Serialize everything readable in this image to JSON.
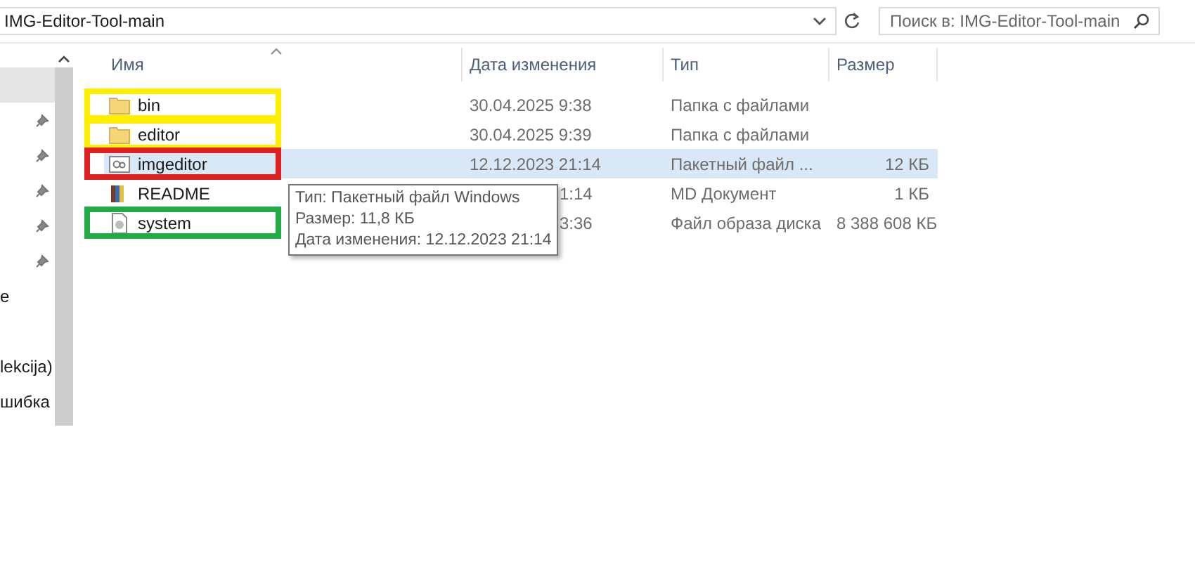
{
  "address_bar": {
    "path": "IMG-Editor-Tool-main"
  },
  "search": {
    "placeholder": "Поиск в: IMG-Editor-Tool-main"
  },
  "nav_pane": {
    "items": [
      {
        "pinned": false,
        "selected": true
      },
      {
        "pinned": true,
        "selected": false
      },
      {
        "pinned": true,
        "selected": false
      },
      {
        "pinned": true,
        "selected": false
      },
      {
        "pinned": true,
        "selected": false
      },
      {
        "pinned": true,
        "selected": false
      },
      {
        "label": "e",
        "pinned": false,
        "selected": false
      },
      {
        "pinned": false,
        "selected": false
      },
      {
        "label": "lekcija)",
        "pinned": false,
        "selected": false
      },
      {
        "label": "шибка",
        "pinned": false,
        "selected": false
      }
    ]
  },
  "table": {
    "columns": [
      "Имя",
      "Дата изменения",
      "Тип",
      "Размер"
    ],
    "rows": [
      {
        "kind": "folder",
        "name": "bin",
        "date": "30.04.2025 9:38",
        "date_covered": false,
        "type": "Папка с файлами",
        "selected": false,
        "color": "#ffee00"
      },
      {
        "kind": "folder",
        "name": "editor",
        "date": "30.04.2025 9:39",
        "date_covered": false,
        "type": "Папка с файлами",
        "selected": false,
        "color": "#ffee00"
      },
      {
        "kind": "batch",
        "name": "imgeditor",
        "date": "12.12.2023 21:14",
        "date_covered": false,
        "type": "Пакетный файл ...",
        "size": "12 КБ",
        "selected": true,
        "color": "#e02020"
      },
      {
        "kind": "document",
        "name": "README",
        "date": "1:14",
        "date_covered": true,
        "type": "MD Документ",
        "size": "1 КБ",
        "selected": false
      },
      {
        "kind": "disk",
        "name": "system",
        "date": "3:36",
        "date_covered": true,
        "type": "Файл образа диска",
        "size": "8 388 608 КБ",
        "selected": false,
        "color": "#22aa44"
      }
    ]
  },
  "tooltip": {
    "lines": [
      "Тип: Пакетный файл Windows",
      "Размер: 11,8 КБ",
      "Дата изменения: 12.12.2023 21:14"
    ]
  }
}
